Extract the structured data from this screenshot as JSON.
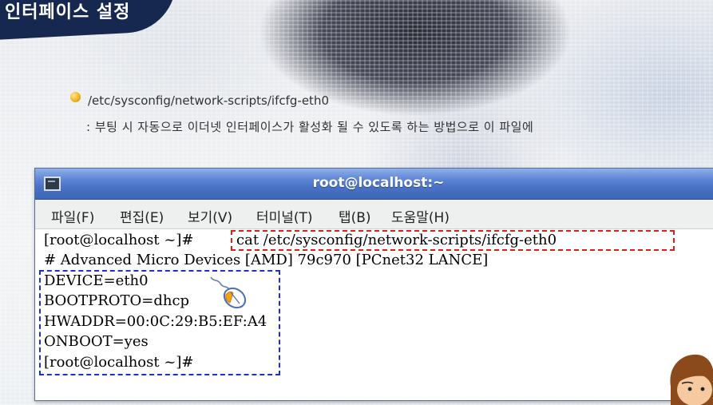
{
  "page": {
    "title": "인터페이스 설정",
    "path": "/etc/sysconfig/network-scripts/ifcfg-eth0",
    "description": ": 부팅 시 자동으로 이더넷 인터페이스가 활성화 될 수 있도록 하는 방법으로 이 파일에"
  },
  "terminal": {
    "title": "root@localhost:~",
    "menu": [
      "파일(F)",
      "편집(E)",
      "보기(V)",
      "터미널(T)",
      "탭(B)",
      "도움말(H)"
    ],
    "prompt": "[root@localhost ~]#",
    "command": "cat /etc/sysconfig/network-scripts/ifcfg-eth0",
    "comment_line": "# Advanced Micro Devices [AMD] 79c970 [PCnet32 LANCE]",
    "config_lines": [
      "DEVICE=eth0",
      "BOOTPROTO=dhcp",
      "HWADDR=00:0C:29:B5:EF:A4",
      "ONBOOT=yes"
    ],
    "final_prompt": "[root@localhost ~]#"
  },
  "colors": {
    "title_background": "#16284f",
    "titlebar_blue": "#4a73c6",
    "command_highlight": "#e51c1c",
    "config_highlight": "#1c2fd6",
    "bullet": "#f3b21a"
  },
  "icons": [
    "terminal-icon",
    "mouse-click-icon",
    "cartoon-face-icon",
    "bullet-icon"
  ]
}
